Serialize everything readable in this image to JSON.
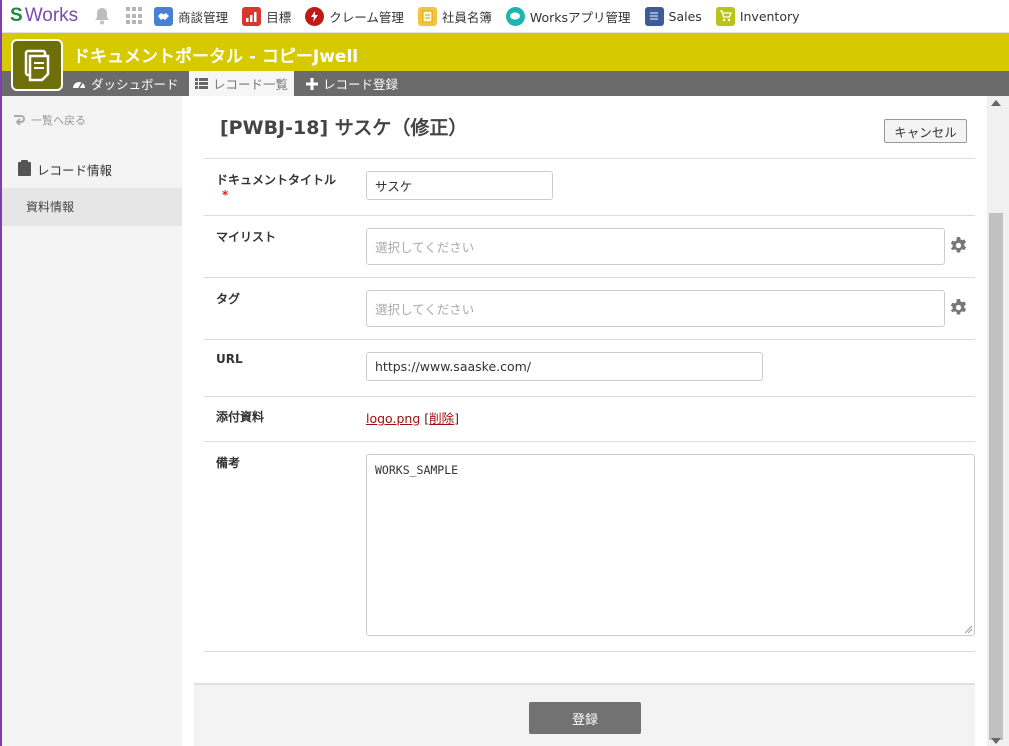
{
  "topbar": {
    "logo_s": "S",
    "logo_text": "Works",
    "apps": [
      {
        "label": "商談管理",
        "icon": "handshake-icon",
        "color": "#4a7fd6"
      },
      {
        "label": "目標",
        "icon": "chart-up-icon",
        "color": "#d9372b"
      },
      {
        "label": "クレーム管理",
        "icon": "claim-icon",
        "color": "#c11919"
      },
      {
        "label": "社員名簿",
        "icon": "notepad-icon",
        "color": "#f2c53d"
      },
      {
        "label": "Worksアプリ管理",
        "icon": "chat-bubble-icon",
        "color": "#1db5b0"
      },
      {
        "label": "Sales",
        "icon": "sales-sheet-icon",
        "color": "#3d5b99"
      },
      {
        "label": "Inventory",
        "icon": "cart-icon",
        "color": "#b8c41a"
      }
    ]
  },
  "header": {
    "title": "ドキュメントポータル - コピーJwell",
    "color": "#d7c900"
  },
  "nav": {
    "dashboard": "ダッシュボード",
    "record_list": "レコード一覧",
    "record_register": "レコード登録"
  },
  "sidebar": {
    "back": "一覧へ戻る",
    "section": "レコード情報",
    "item": "資料情報"
  },
  "record": {
    "title": "[PWBJ-18] サスケ（修正）",
    "cancel": "キャンセル"
  },
  "form": {
    "doc_title_label": "ドキュメントタイトル",
    "required_mark": "*",
    "doc_title_value": "サスケ",
    "mylist_label": "マイリスト",
    "mylist_placeholder": "選択してください",
    "tag_label": "タグ",
    "tag_placeholder": "選択してください",
    "url_label": "URL",
    "url_value": "https://www.saaske.com/",
    "attach_label": "添付資料",
    "attach_file": "logo.png",
    "attach_delete": "削除",
    "note_label": "備考",
    "note_value": "WORKS_SAMPLE"
  },
  "footer": {
    "submit": "登録"
  }
}
